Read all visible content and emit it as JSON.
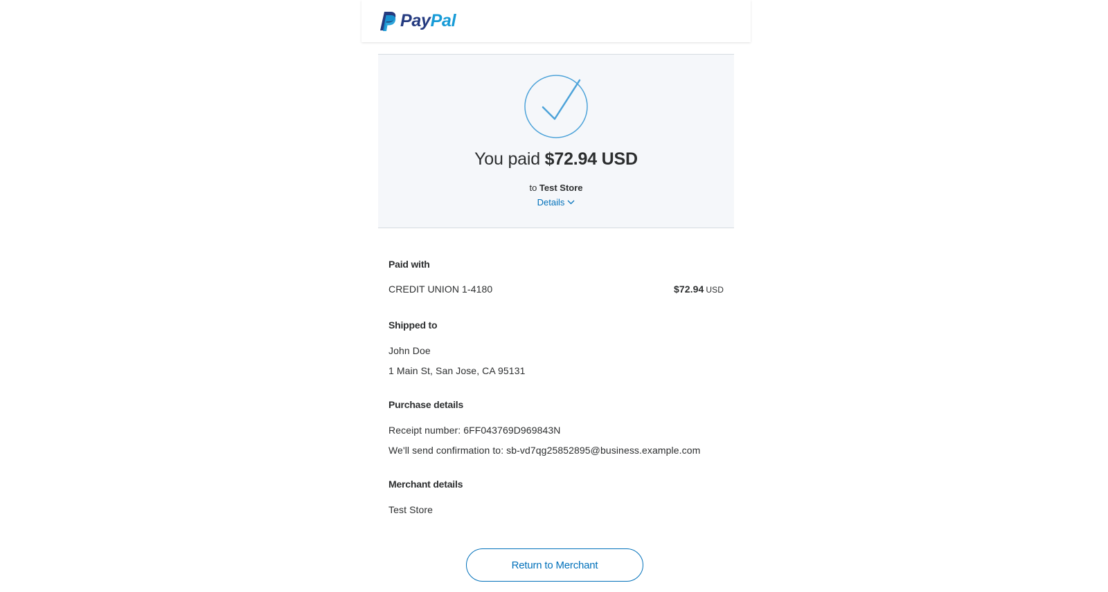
{
  "brand": {
    "logo_pay": "Pay",
    "logo_pal": "Pal"
  },
  "summary": {
    "paid_prefix": "You paid",
    "amount": "$72.94 USD",
    "to_prefix": "to",
    "merchant": "Test Store",
    "details_label": "Details"
  },
  "paid_with": {
    "title": "Paid with",
    "method": "CREDIT UNION 1-4180",
    "amount": "$72.94",
    "currency": "USD"
  },
  "shipped_to": {
    "title": "Shipped to",
    "name": "John Doe",
    "address": "1 Main St, San Jose, CA 95131"
  },
  "purchase_details": {
    "title": "Purchase details",
    "receipt": "Receipt number: 6FF043769D969843N",
    "confirmation": "We'll send confirmation to: sb-vd7qg25852895@business.example.com"
  },
  "merchant_details": {
    "title": "Merchant details",
    "name": "Test Store"
  },
  "actions": {
    "return_label": "Return to Merchant"
  },
  "colors": {
    "accent": "#0070ba",
    "check": "#4da3d9",
    "summary_bg": "#f5f7fa",
    "brand_dark": "#253b80",
    "brand_light": "#179bd7"
  },
  "icons": {
    "logo": "paypal-logo-icon",
    "success": "checkmark-circle-icon",
    "details_toggle": "chevron-down-icon"
  }
}
